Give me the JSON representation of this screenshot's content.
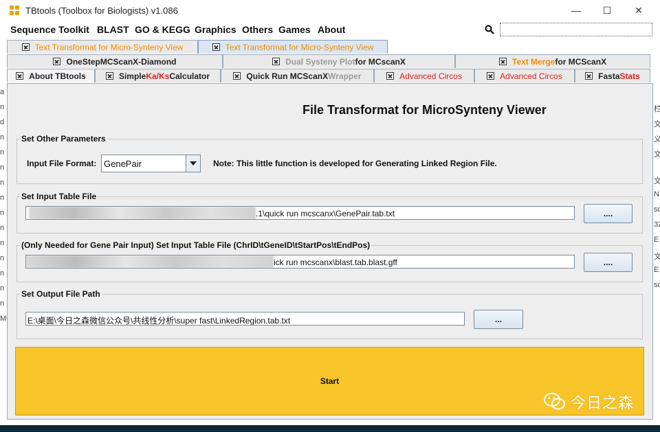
{
  "window": {
    "title": "TBtools (Toolbox for Biologists) v1.086",
    "controls": {
      "minimize": "—",
      "maximize": "☐",
      "close": "✕"
    }
  },
  "menu": [
    "Sequence Toolkit",
    "BLAST",
    "GO & KEGG",
    "Graphics",
    "Others",
    "Games",
    "About"
  ],
  "tabs": {
    "row1": [
      {
        "parts": [
          {
            "t": "Text Transformat for Micro-Synteny View",
            "c": "orange"
          }
        ]
      },
      {
        "parts": [
          {
            "t": "Text Transformat for Micro-Synteny View",
            "c": "orange"
          }
        ]
      }
    ],
    "row2": [
      {
        "parts": [
          {
            "t": "OneStepMCScanX-Diamond",
            "c": "dark"
          }
        ]
      },
      {
        "parts": [
          {
            "t": "Dual Systeny Plot",
            "c": "gray"
          },
          {
            "t": " for MCscanX",
            "c": "dark"
          }
        ]
      },
      {
        "parts": [
          {
            "t": "Text Merge",
            "c": "orange"
          },
          {
            "t": " for MCScanX",
            "c": "dark"
          }
        ]
      }
    ],
    "row3": [
      {
        "parts": [
          {
            "t": "About TBtools",
            "c": "dark"
          }
        ]
      },
      {
        "parts": [
          {
            "t": "Simple ",
            "c": "dark"
          },
          {
            "t": "Ka/Ks",
            "c": "red"
          },
          {
            "t": " Calculator",
            "c": "dark"
          }
        ]
      },
      {
        "parts": [
          {
            "t": "Quick Run MCScanX ",
            "c": "dark"
          },
          {
            "t": "Wrapper",
            "c": "gray"
          }
        ]
      },
      {
        "parts": [
          {
            "t": "Advanced Circos",
            "c": "red"
          }
        ]
      },
      {
        "parts": [
          {
            "t": "Advanced Circos",
            "c": "red"
          }
        ]
      },
      {
        "parts": [
          {
            "t": "Fasta ",
            "c": "dark"
          },
          {
            "t": "Stats",
            "c": "red"
          }
        ]
      }
    ]
  },
  "main": {
    "title": "File Transformat for MicroSynteny Viewer",
    "other_params": {
      "group_title": "Set Other Parameters",
      "format_label": "Input File Format:",
      "format_value": "GenePair",
      "note": "Note: This little function is developed for Generating Linked Region File."
    },
    "input_table": {
      "group_title": "Set Input Table File",
      "path_suffix": ".1\\quick run mcscanx\\GenePair.tab.txt",
      "browse_label": "...."
    },
    "gene_pair_table": {
      "group_title": "(Only Needed for Gene Pair Input) Set Input Table File (ChrID\\tGeneID\\tStartPos\\tEndPos)",
      "path_suffix": "ick run mcscanx\\blast.tab.blast.gff",
      "browse_label": "...."
    },
    "output": {
      "group_title": "Set Output File Path",
      "path": "E:\\桌面\\今日之森微信公众号\\共线性分析\\super fast\\LinkedRegion.tab.txt",
      "browse_label": "..."
    },
    "start_label": "Start"
  },
  "watermark": "今日之森",
  "background_fragments": {
    "left": [
      "a",
      "n",
      "d",
      "n",
      "n",
      "n",
      "n",
      "n",
      "n",
      "n",
      "n",
      "n",
      "n",
      "n",
      "n",
      "Mi"
    ],
    "right": [
      "栏",
      "文",
      "义",
      "文",
      "文",
      "N",
      "sc",
      "32",
      "E",
      "文",
      "E",
      "sc"
    ]
  }
}
